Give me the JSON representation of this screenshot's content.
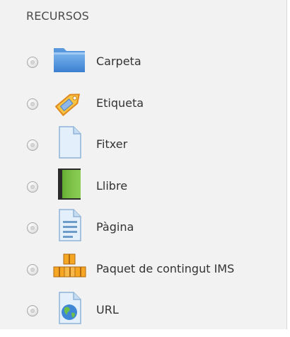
{
  "section": {
    "title": "RECURSOS",
    "items": [
      {
        "label": "Carpeta",
        "icon": "folder-icon"
      },
      {
        "label": "Etiqueta",
        "icon": "tag-label-icon"
      },
      {
        "label": "Fitxer",
        "icon": "file-icon"
      },
      {
        "label": "Llibre",
        "icon": "book-icon"
      },
      {
        "label": "Pàgina",
        "icon": "page-icon"
      },
      {
        "label": "Paquet de contingut IMS",
        "icon": "ims-package-icon"
      },
      {
        "label": "URL",
        "icon": "url-globe-icon"
      }
    ]
  },
  "colors": {
    "panel_background": "#f2f2f2",
    "text": "#333333",
    "heading": "#4a4a4a",
    "folder_blue": "#4a90d9",
    "book_green": "#7ac143",
    "package_orange": "#f5a623"
  }
}
